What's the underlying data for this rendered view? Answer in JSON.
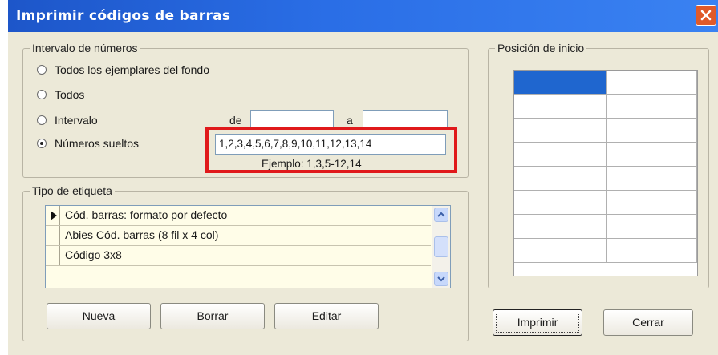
{
  "window": {
    "title": "Imprimir códigos de barras",
    "close_icon": "close-icon",
    "colors": {
      "titlebar": "#2a6ee6",
      "close": "#e05a2a",
      "highlight": "#e0191b",
      "selected_cell": "#1f66cf"
    }
  },
  "interval_group": {
    "legend": "Intervalo de números",
    "options": [
      {
        "label": "Todos los ejemplares del fondo",
        "checked": false
      },
      {
        "label": "Todos",
        "checked": false
      },
      {
        "label": "Intervalo",
        "checked": false
      },
      {
        "label": "Números sueltos",
        "checked": true
      }
    ],
    "from_label": "de",
    "from_value": "",
    "to_label": "a",
    "to_value": "",
    "numbers_value": "1,2,3,4,5,6,7,8,9,10,11,12,13,14",
    "example": "Ejemplo: 1,3,5-12,14"
  },
  "label_group": {
    "legend": "Tipo de etiqueta",
    "items": [
      {
        "label": "Cód. barras: formato por defecto",
        "current": true
      },
      {
        "label": "Abies Cód. barras (8 fil x 4 col)",
        "current": false
      },
      {
        "label": "Código 3x8",
        "current": false
      }
    ],
    "buttons": {
      "new": "Nueva",
      "delete": "Borrar",
      "edit": "Editar"
    }
  },
  "position_group": {
    "legend": "Posición de inicio",
    "rows": 8,
    "cols": 2,
    "selected": {
      "row": 1,
      "col": 1
    }
  },
  "footer": {
    "print": "Imprimir",
    "close": "Cerrar"
  }
}
